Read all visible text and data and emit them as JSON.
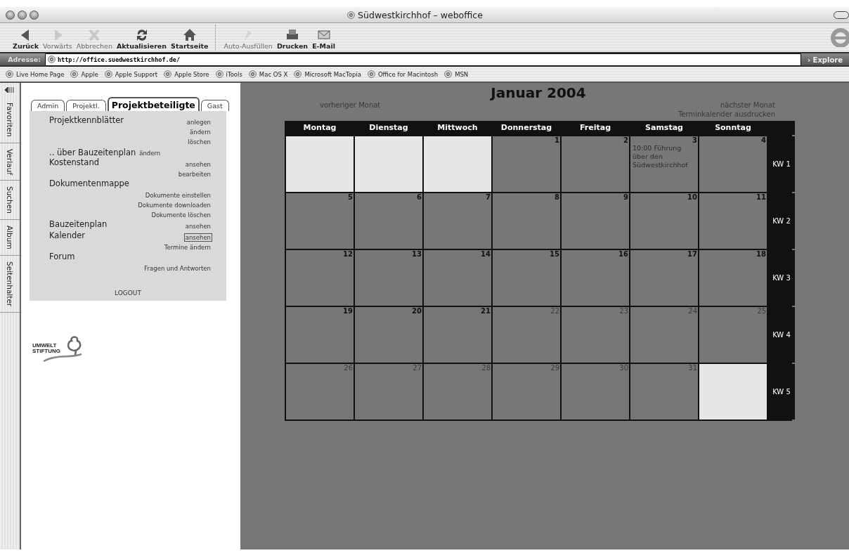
{
  "window": {
    "title": "Südwestkirchhof – weboffice"
  },
  "toolbar": [
    {
      "label": "Zurück",
      "kind": "back",
      "disabled": false
    },
    {
      "label": "Vorwärts",
      "kind": "forward",
      "disabled": true
    },
    {
      "label": "Abbrechen",
      "kind": "stop",
      "disabled": true
    },
    {
      "label": "Aktualisieren",
      "kind": "refresh",
      "disabled": false
    },
    {
      "label": "Startseite",
      "kind": "home",
      "disabled": false
    },
    {
      "label": "Auto-Ausfüllen",
      "kind": "autofill",
      "disabled": true
    },
    {
      "label": "Drucken",
      "kind": "print",
      "disabled": false
    },
    {
      "label": "E-Mail",
      "kind": "mail",
      "disabled": false
    }
  ],
  "address": {
    "label": "Adresse:",
    "value": "http://office.suedwestkirchhof.de/",
    "go": "› Explore"
  },
  "favorites": [
    "Live Home Page",
    "Apple",
    "Apple Support",
    "Apple Store",
    "iTools",
    "Mac OS X",
    "Microsoft MacTopia",
    "Office for Macintosh",
    "MSN"
  ],
  "side_tabs": [
    "Favoriten",
    "Verlauf",
    "Suchen",
    "Album",
    "Seitenhalter"
  ],
  "nav": {
    "tabs": [
      {
        "label": "Admin",
        "selected": false
      },
      {
        "label": "Projektl.",
        "selected": false
      },
      {
        "label": "Projektbeteiligte",
        "selected": true
      },
      {
        "label": "Gast",
        "selected": false
      }
    ],
    "entries": [
      {
        "kind": "section",
        "label": "Projektkennblätter",
        "actions": [
          {
            "label": "anlegen",
            "focused": false
          },
          {
            "label": "ändern",
            "focused": false
          },
          {
            "label": "löschen",
            "focused": false
          }
        ]
      },
      {
        "kind": "inline",
        "label": ".. über Bauzeitenplan",
        "action": "ändern"
      },
      {
        "kind": "section",
        "label": "Kostenstand",
        "actions": [
          {
            "label": "ansehen",
            "focused": false
          },
          {
            "label": "bearbeiten",
            "focused": false
          }
        ]
      },
      {
        "kind": "section",
        "label": "Dokumentenmappe"
      },
      {
        "kind": "links",
        "actions": [
          {
            "label": "Dokumente einstellen",
            "focused": false
          },
          {
            "label": "Dokumente downloaden",
            "focused": false
          },
          {
            "label": "Dokumente löschen",
            "focused": false
          }
        ]
      },
      {
        "kind": "section",
        "label": "Bauzeitenplan",
        "actions": [
          {
            "label": "ansehen",
            "focused": false
          }
        ]
      },
      {
        "kind": "section",
        "label": "Kalender",
        "actions": [
          {
            "label": "ansehen",
            "focused": true
          },
          {
            "label": "Termine ändern",
            "focused": false
          }
        ]
      },
      {
        "kind": "section",
        "label": "Forum"
      },
      {
        "kind": "links",
        "actions": [
          {
            "label": "Fragen und Antworten",
            "focused": false
          }
        ]
      }
    ],
    "logout": "LOGOUT"
  },
  "logo": {
    "lines": [
      "UMWELT",
      "STIFTUNG"
    ]
  },
  "calendar": {
    "title": "Januar 2004",
    "prev": "vorheriger Monat",
    "next": "nächster Monat",
    "print": "Terminkalender ausdrucken",
    "weekdays": [
      "Montag",
      "Dienstag",
      "Mittwoch",
      "Donnerstag",
      "Freitag",
      "Samstag",
      "Sonntag"
    ],
    "weeks": [
      {
        "label": "KW 1",
        "days": [
          {
            "kind": "blank"
          },
          {
            "kind": "blank"
          },
          {
            "kind": "blank"
          },
          {
            "kind": "day",
            "number": "1",
            "dimmed": false
          },
          {
            "kind": "day",
            "number": "2",
            "dimmed": false
          },
          {
            "kind": "day",
            "number": "3",
            "dimmed": false,
            "event": "10:00 Führung über den Südwestkirchhof"
          },
          {
            "kind": "day",
            "number": "4",
            "dimmed": false
          }
        ]
      },
      {
        "label": "KW 2",
        "days": [
          {
            "kind": "day",
            "number": "5",
            "dimmed": false
          },
          {
            "kind": "day",
            "number": "6",
            "dimmed": false
          },
          {
            "kind": "day",
            "number": "7",
            "dimmed": false
          },
          {
            "kind": "day",
            "number": "8",
            "dimmed": false
          },
          {
            "kind": "day",
            "number": "9",
            "dimmed": false
          },
          {
            "kind": "day",
            "number": "10",
            "dimmed": false
          },
          {
            "kind": "day",
            "number": "11",
            "dimmed": false
          }
        ]
      },
      {
        "label": "KW 3",
        "days": [
          {
            "kind": "day",
            "number": "12",
            "dimmed": false
          },
          {
            "kind": "day",
            "number": "13",
            "dimmed": false
          },
          {
            "kind": "day",
            "number": "14",
            "dimmed": false
          },
          {
            "kind": "day",
            "number": "15",
            "dimmed": false
          },
          {
            "kind": "day",
            "number": "16",
            "dimmed": false
          },
          {
            "kind": "day",
            "number": "17",
            "dimmed": false
          },
          {
            "kind": "day",
            "number": "18",
            "dimmed": false
          }
        ]
      },
      {
        "label": "KW 4",
        "days": [
          {
            "kind": "day",
            "number": "19",
            "dimmed": false
          },
          {
            "kind": "day",
            "number": "20",
            "dimmed": false
          },
          {
            "kind": "day",
            "number": "21",
            "dimmed": false
          },
          {
            "kind": "day",
            "number": "22",
            "dimmed": true
          },
          {
            "kind": "day",
            "number": "23",
            "dimmed": true
          },
          {
            "kind": "day",
            "number": "24",
            "dimmed": true
          },
          {
            "kind": "day",
            "number": "25",
            "dimmed": true
          }
        ]
      },
      {
        "label": "KW 5",
        "days": [
          {
            "kind": "day",
            "number": "26",
            "dimmed": true
          },
          {
            "kind": "day",
            "number": "27",
            "dimmed": true
          },
          {
            "kind": "day",
            "number": "28",
            "dimmed": true
          },
          {
            "kind": "day",
            "number": "29",
            "dimmed": true
          },
          {
            "kind": "day",
            "number": "30",
            "dimmed": true
          },
          {
            "kind": "day",
            "number": "31",
            "dimmed": true
          },
          {
            "kind": "blank"
          }
        ]
      }
    ]
  }
}
